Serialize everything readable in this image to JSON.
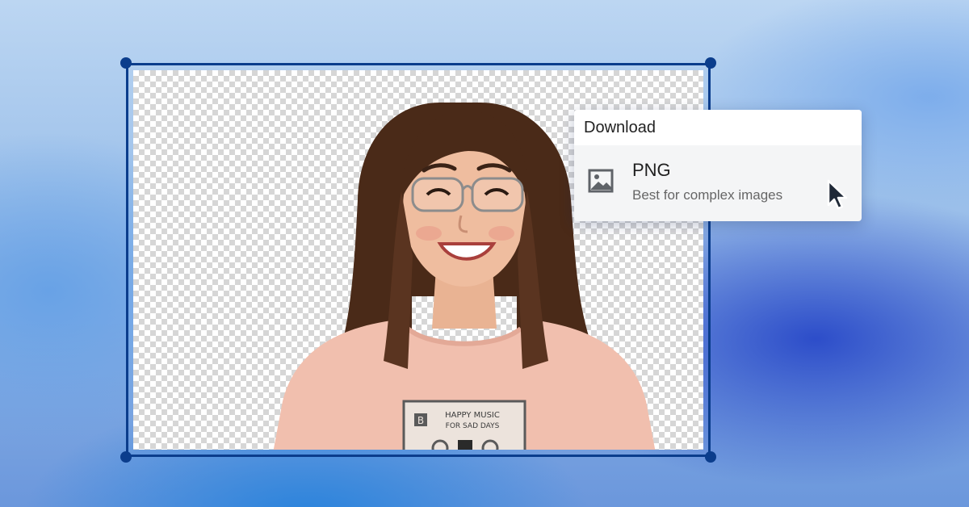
{
  "canvas": {
    "background_colors": [
      "#bcd6f2",
      "#6b97dc",
      "#2848c8"
    ],
    "selection_color": "#0b3d8c",
    "checker_colors": [
      "#ffffff",
      "#d6d6d6"
    ]
  },
  "photo": {
    "subject": "smiling-person-cutout",
    "shirt_graphic_text": [
      "HAPPY MUSIC",
      "FOR SAD DAYS",
      "B"
    ]
  },
  "download_menu": {
    "title": "Download",
    "options": [
      {
        "icon": "image-icon",
        "label": "PNG",
        "description": "Best for complex images"
      }
    ]
  },
  "cursor": {
    "icon": "arrow-pointer-icon"
  }
}
